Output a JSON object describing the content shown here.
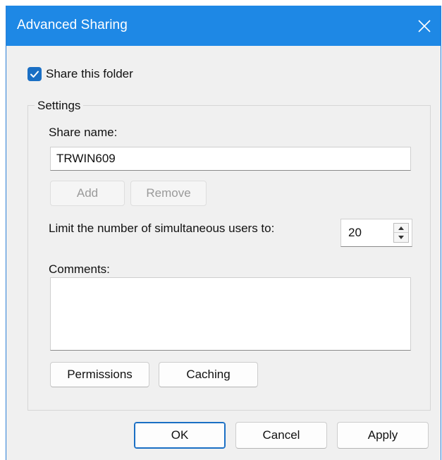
{
  "window": {
    "title": "Advanced Sharing",
    "close_icon": "close-icon"
  },
  "share_checkbox": {
    "label": "Share this folder",
    "checked": true
  },
  "settings": {
    "legend": "Settings",
    "share_name_label": "Share name:",
    "share_name_value": "TRWIN609",
    "add_label": "Add",
    "remove_label": "Remove",
    "limit_label": "Limit the number of simultaneous users to:",
    "limit_value": "20",
    "comments_label": "Comments:",
    "comments_value": "",
    "permissions_label": "Permissions",
    "caching_label": "Caching"
  },
  "footer": {
    "ok_label": "OK",
    "cancel_label": "Cancel",
    "apply_label": "Apply"
  },
  "colors": {
    "titlebar": "#1e88e5",
    "accent": "#1a6fc4",
    "background": "#f0f0f0"
  }
}
